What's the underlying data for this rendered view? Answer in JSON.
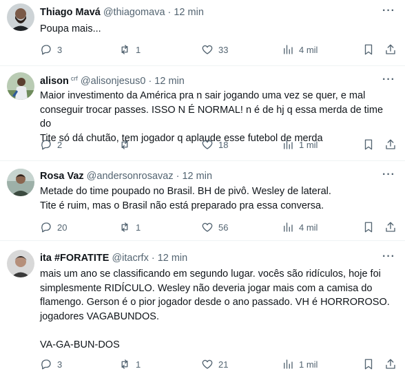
{
  "tweets": [
    {
      "name": "Thiago Mavá",
      "badge": "",
      "handle": "@thiagomava",
      "separator": "·",
      "time": "12 min",
      "text": "Poupa mais...",
      "replies": "3",
      "retweets": "1",
      "likes": "33",
      "views": "4 mil"
    },
    {
      "name": "alison",
      "badge": "crf",
      "handle": "@alisonjesus0",
      "separator": "·",
      "time": "12 min",
      "text": "Maior investimento da América  pra n sair jogando uma vez se quer, e mal\nconseguir trocar passes. ISSO N É NORMAL! n é de hj q essa merda de time do\nTite só dá chutão, tem jogador q aplaude esse futebol de merda",
      "replies": "2",
      "retweets": "",
      "likes": "18",
      "views": "1 mil"
    },
    {
      "name": "Rosa Vaz",
      "badge": "",
      "handle": "@andersonrosavaz",
      "separator": "·",
      "time": "12 min",
      "text": "Metade do time poupado no Brasil. BH de pivô. Wesley de lateral.\nTite é ruim, mas o Brasil não está preparado pra essa conversa.",
      "replies": "20",
      "retweets": "1",
      "likes": "56",
      "views": "4 mil"
    },
    {
      "name": "ita #FORATITE",
      "badge": "",
      "handle": "@itacrfx",
      "separator": "·",
      "time": "12 min",
      "text": "mais um ano se classificando em segundo lugar. vocês são ridículos, hoje foi\nsimplesmente RIDÍCULO. Wesley não deveria jogar mais com a camisa do\nflamengo. Gerson é o pior jogador desde o ano passado. VH é HORROROSO.\njogadores VAGABUNDOS.\n\nVA-GA-BUN-DOS",
      "replies": "3",
      "retweets": "1",
      "likes": "21",
      "views": "1 mil"
    }
  ],
  "icons": {
    "more": "more-dots-icon",
    "reply": "reply-icon",
    "retweet": "retweet-icon",
    "like": "heart-icon",
    "views": "views-chart-icon",
    "bookmark": "bookmark-icon",
    "share": "share-icon"
  },
  "colors": {
    "text": "#0f1419",
    "secondary": "#536471",
    "divider": "#eff3f4"
  }
}
